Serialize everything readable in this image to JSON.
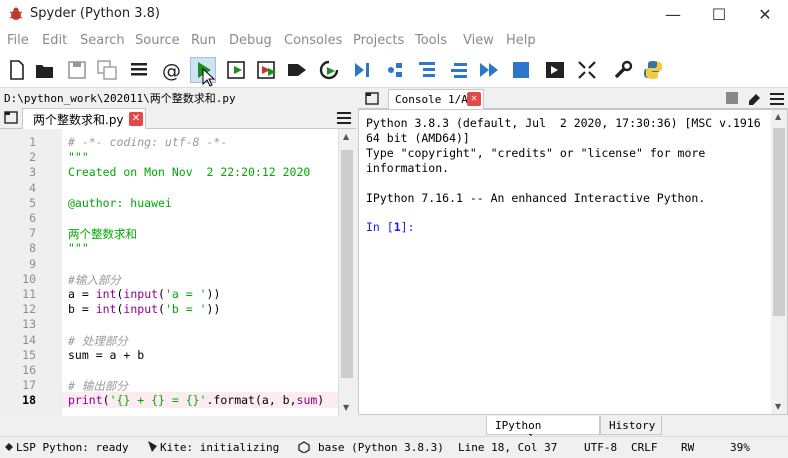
{
  "window": {
    "title": "Spyder (Python 3.8)",
    "minimize": "—",
    "maximize": "☐",
    "close": "✕"
  },
  "menu": [
    "File",
    "Edit",
    "Search",
    "Source",
    "Run",
    "Debug",
    "Consoles",
    "Projects",
    "Tools",
    "View",
    "Help"
  ],
  "toolbar": {
    "icons": [
      "new-file-icon",
      "open-folder-icon",
      "save-icon",
      "save-all-icon",
      "list-icon",
      "at-icon",
      "run-icon",
      "run-cell-icon",
      "run-cell-advance-icon",
      "run-selection-icon",
      "rerun-icon",
      "debug-icon",
      "step-icon",
      "step-into-icon",
      "step-return-icon",
      "continue-icon",
      "stop-icon",
      "maximize-pane-icon",
      "fullscreen-icon",
      "wrench-icon",
      "python-icon"
    ]
  },
  "editor": {
    "path": "D:\\python_work\\202011\\两个整数求和.py",
    "tab_label": "两个整数求和.py",
    "tab_close": "✕",
    "current_line": "18",
    "lines": [
      {
        "n": "1",
        "segments": [
          {
            "cls": "c-comment",
            "text": "# -*- coding: utf-8 -*-"
          }
        ]
      },
      {
        "n": "2",
        "segments": [
          {
            "cls": "c-string",
            "text": "\"\"\""
          }
        ]
      },
      {
        "n": "3",
        "segments": [
          {
            "cls": "c-string",
            "text": "Created on Mon Nov  2 22:20:12 2020"
          }
        ]
      },
      {
        "n": "4",
        "segments": []
      },
      {
        "n": "5",
        "segments": [
          {
            "cls": "c-string",
            "text": "@author: huawei"
          }
        ]
      },
      {
        "n": "6",
        "segments": []
      },
      {
        "n": "7",
        "segments": [
          {
            "cls": "c-string",
            "text": "两个整数求和"
          }
        ]
      },
      {
        "n": "8",
        "segments": [
          {
            "cls": "c-string",
            "text": "\"\"\""
          }
        ]
      },
      {
        "n": "9",
        "segments": []
      },
      {
        "n": "10",
        "segments": [
          {
            "cls": "c-comment",
            "text": "#输入部分"
          }
        ]
      },
      {
        "n": "11",
        "segments": [
          {
            "cls": "c-default",
            "text": "a = "
          },
          {
            "cls": "c-builtin",
            "text": "int"
          },
          {
            "cls": "c-default",
            "text": "("
          },
          {
            "cls": "c-builtin",
            "text": "input"
          },
          {
            "cls": "c-default",
            "text": "("
          },
          {
            "cls": "c-string",
            "text": "'a = '"
          },
          {
            "cls": "c-default",
            "text": "))"
          }
        ]
      },
      {
        "n": "12",
        "segments": [
          {
            "cls": "c-default",
            "text": "b = "
          },
          {
            "cls": "c-builtin",
            "text": "int"
          },
          {
            "cls": "c-default",
            "text": "("
          },
          {
            "cls": "c-builtin",
            "text": "input"
          },
          {
            "cls": "c-default",
            "text": "("
          },
          {
            "cls": "c-string",
            "text": "'b = '"
          },
          {
            "cls": "c-default",
            "text": "))"
          }
        ]
      },
      {
        "n": "13",
        "segments": []
      },
      {
        "n": "14",
        "segments": [
          {
            "cls": "c-comment",
            "text": "# 处理部分"
          }
        ]
      },
      {
        "n": "15",
        "segments": [
          {
            "cls": "c-default",
            "text": "sum = a + b"
          }
        ]
      },
      {
        "n": "16",
        "segments": []
      },
      {
        "n": "17",
        "segments": [
          {
            "cls": "c-comment",
            "text": "# 输出部分"
          }
        ]
      },
      {
        "n": "18",
        "segments": [
          {
            "cls": "c-builtin",
            "text": "print"
          },
          {
            "cls": "c-default",
            "text": "("
          },
          {
            "cls": "c-string",
            "text": "'{} + {} = {}'"
          },
          {
            "cls": "c-default",
            "text": ".format("
          },
          {
            "cls": "c-default",
            "text": "a, b,"
          },
          {
            "cls": "c-builtin",
            "text": "sum"
          },
          {
            "cls": "c-default",
            "text": ")"
          }
        ]
      }
    ]
  },
  "console": {
    "tab_label": "Console 1/A",
    "tab_close": "✕",
    "lines": [
      "Python 3.8.3 (default, Jul  2 2020, 17:30:36) [MSC v.1916",
      "64 bit (AMD64)]",
      "Type \"copyright\", \"credits\" or \"license\" for more",
      "information.",
      "",
      "IPython 7.16.1 -- An enhanced Interactive Python.",
      ""
    ],
    "prompt_in": "In [",
    "prompt_num": "1",
    "prompt_end": "]:",
    "bottom_tabs": [
      "IPython console",
      "History"
    ]
  },
  "status": {
    "lsp": "LSP Python: ready",
    "kite": "Kite: initializing",
    "env": "base (Python 3.8.3)",
    "position": "Line 18, Col 37",
    "encoding": "UTF-8",
    "eol": "CRLF",
    "mode": "RW",
    "memory": "39%"
  },
  "colors": {
    "run_green": "#1e8c1e",
    "tab_close_red": "#e24a4a",
    "toolbar_blue": "#2d77c9"
  }
}
